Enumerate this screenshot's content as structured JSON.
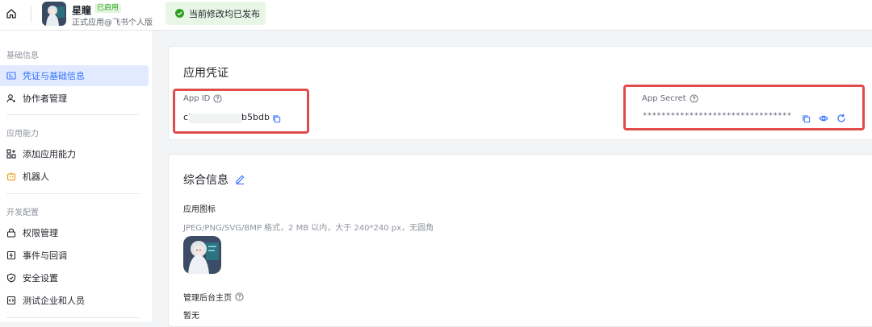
{
  "topbar": {
    "app_name": "星瞳",
    "app_badge": "已启用",
    "app_subtitle": "正式应用@飞书个人版",
    "publish_status": "当前修改均已发布"
  },
  "sidebar": {
    "section_basic": "基础信息",
    "item_credentials": "凭证与基础信息",
    "item_collaborators": "协作者管理",
    "section_capabilities": "应用能力",
    "item_add_capability": "添加应用能力",
    "item_bot": "机器人",
    "section_dev": "开发配置",
    "item_permissions": "权限管理",
    "item_events": "事件与回调",
    "item_security": "安全设置",
    "item_test_org": "测试企业和人员"
  },
  "credentials": {
    "title": "应用凭证",
    "app_id_label": "App ID",
    "app_id_prefix": "cl",
    "app_id_suffix": "b5bdb",
    "app_secret_label": "App Secret",
    "app_secret_masked": "********************************"
  },
  "general": {
    "title": "综合信息",
    "icon_label": "应用图标",
    "icon_hint": "JPEG/PNG/SVG/BMP 格式，2 MB 以内，大于 240*240 px，无圆角",
    "admin_home_label": "管理后台主页",
    "admin_home_value": "暂无"
  },
  "colors": {
    "accent": "#3370ff",
    "highlight_box": "#e04b4b",
    "success": "#2ea121"
  }
}
